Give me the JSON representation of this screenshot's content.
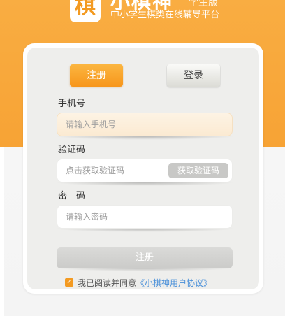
{
  "header": {
    "logo_glyph": "棋",
    "app_title": "小棋神",
    "edition": "学生版",
    "subtitle": "中小学生棋类在线辅导平台"
  },
  "tabs": {
    "register": "注册",
    "login": "登录"
  },
  "form": {
    "phone_label": "手机号",
    "phone_placeholder": "请输入手机号",
    "code_label": "验证码",
    "code_placeholder": "点击获取验证码",
    "get_code_button": "获取验证码",
    "password_label": "密　码",
    "password_placeholder": "请输入密码",
    "submit_button": "注册"
  },
  "agreement": {
    "text": "我已阅读并同意",
    "link": "《小棋神用户协议》",
    "checked": true
  },
  "colors": {
    "brand_orange": "#f7a335",
    "link_blue": "#4a90d9"
  }
}
